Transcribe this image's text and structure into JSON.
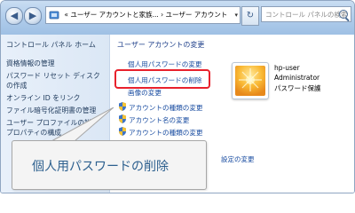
{
  "addressbar": {
    "prefix": "«",
    "breadcrumb_1": "ユーザー アカウントと家族...",
    "separator": "›",
    "breadcrumb_2": "ユーザー アカウント",
    "dropdown": "▾"
  },
  "search": {
    "placeholder": "コントロール パネルの検索"
  },
  "nav": {
    "back": "◀",
    "forward": "▶",
    "refresh": "↻"
  },
  "sidebar": {
    "title": "コントロール パネル ホーム",
    "items": [
      {
        "label": "資格情報の管理"
      },
      {
        "label": "パスワード リセット ディスク"
      },
      {
        "label": "の作成"
      },
      {
        "label": "オンライン ID をリンク"
      },
      {
        "label": "ファイル暗号化証明書の管理"
      },
      {
        "label": "ユーザー プロファイルの詳"
      },
      {
        "label": "プロパティの構成"
      }
    ]
  },
  "main": {
    "heading": "ユーザー アカウントの変更",
    "links": [
      {
        "label": "個人用パスワードの変更"
      },
      {
        "label": "個人用パスワードの削除"
      },
      {
        "label": "画像の変更"
      },
      {
        "label": "アカウントの種類の変更"
      },
      {
        "label": "アカウント名の変更"
      },
      {
        "label": "アカウントの種類の変更"
      }
    ],
    "partial_link": "設定の変更"
  },
  "user": {
    "name": "hp-user",
    "role": "Administrator",
    "status": "パスワード保護"
  },
  "callout": {
    "text": "個人用パスワードの削除"
  },
  "colors": {
    "link": "#1a4da1",
    "highlight": "#e8212c",
    "callout_text": "#2c5f8e",
    "sidebar_bg": "#dbe7f5"
  }
}
